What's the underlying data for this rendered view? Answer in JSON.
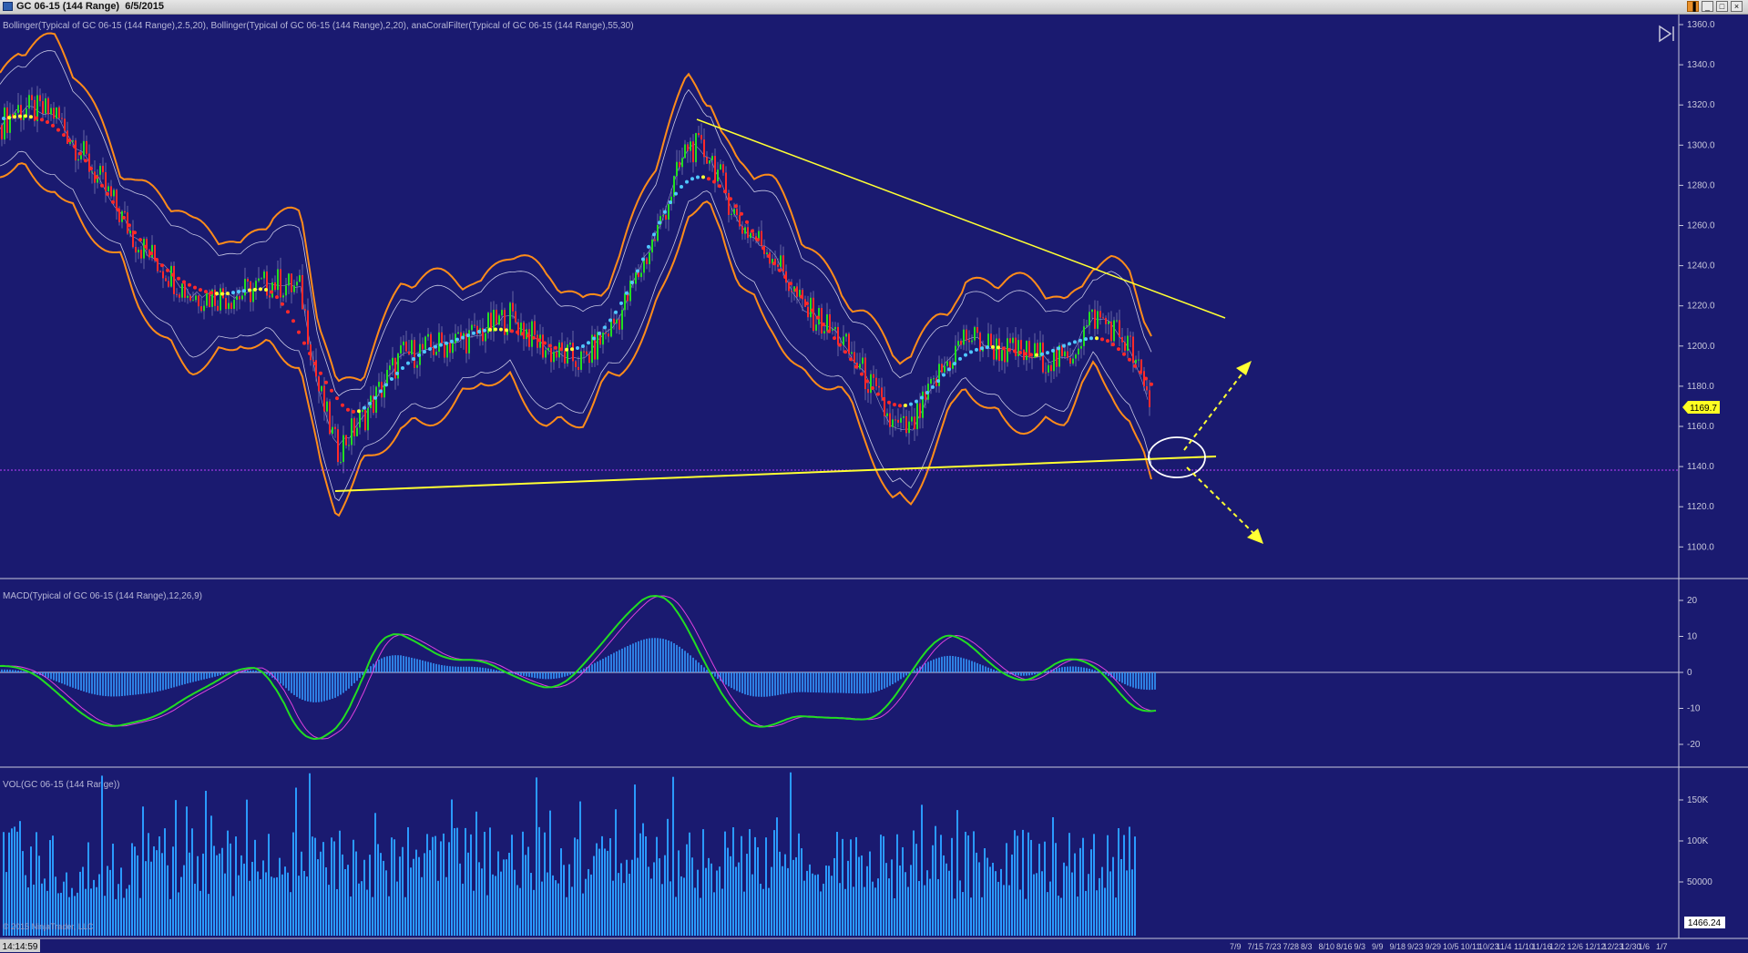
{
  "window": {
    "title": "GC 06-15 (144 Range)  6/5/2015",
    "buttons": [
      "restore-icon",
      "minimize-icon",
      "maximize-icon",
      "close-icon"
    ]
  },
  "price_panel": {
    "indicator_label": "Bollinger(Typical of GC 06-15 (144 Range),2.5,20), Bollinger(Typical of GC 06-15 (144 Range),2,20), anaCoralFilter(Typical of GC 06-15 (144 Range),55,30)",
    "ticks": [
      "1360.0",
      "1340.0",
      "1320.0",
      "1300.0",
      "1280.0",
      "1260.0",
      "1240.0",
      "1220.0",
      "1200.0",
      "1180.0",
      "1160.0",
      "1140.0",
      "1120.0",
      "1100.0"
    ],
    "last_price": "1169.7",
    "support_level": 1142
  },
  "macd_panel": {
    "label": "MACD(Typical of GC 06-15 (144 Range),12,26,9)",
    "ticks": [
      "20",
      "10",
      "0",
      "-10",
      "-20"
    ]
  },
  "volume_panel": {
    "label": "VOL(GC 06-15 (144 Range))",
    "ticks": [
      "150K",
      "100K",
      "50000"
    ],
    "last_volume": "1466.24",
    "copyright": "© 2015 NinjaTrader, LLC"
  },
  "time_axis": {
    "clock": "14:14:59",
    "future_labels": [
      "7/9",
      "7/15",
      "7/23",
      "7/28",
      "8/3",
      "8/10",
      "8/16",
      "9/3",
      "9/9",
      "9/18",
      "9/23",
      "9/29",
      "10/5",
      "10/11",
      "10/23",
      "11/4",
      "11/10",
      "11/16",
      "12/2",
      "12/6",
      "12/12",
      "12/23",
      "12/30",
      "1/6",
      "1/7"
    ]
  },
  "colors": {
    "background": "#1a1a70",
    "outer_band": "#ff8c1a",
    "inner_band": "#c8c8e6",
    "coral_up": "#4fc7ff",
    "coral_down": "#ff2a2a",
    "coral_flat": "#ffff33",
    "trendline": "#ffff33",
    "support_line": "#c040ff",
    "macd_line": "#22dd22",
    "signal_line": "#e040e0",
    "histogram": "#3399ff",
    "volume": "#2a9aff"
  }
}
